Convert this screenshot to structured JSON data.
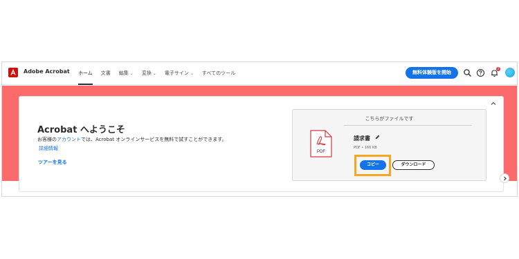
{
  "header": {
    "brand": "Adobe Acrobat",
    "nav": [
      {
        "label": "ホーム",
        "has_menu": false
      },
      {
        "label": "文書",
        "has_menu": false
      },
      {
        "label": "編集",
        "has_menu": true
      },
      {
        "label": "変換",
        "has_menu": true
      },
      {
        "label": "電子サイン",
        "has_menu": true
      },
      {
        "label": "すべてのツール",
        "has_menu": false
      }
    ],
    "trial_button": "無料体験版を開始",
    "notification_count": "2",
    "icons": [
      "search-icon",
      "help-icon",
      "bell-icon",
      "avatar"
    ]
  },
  "welcome": {
    "title": "Acrobat へようこそ",
    "desc_pre": "お客様の",
    "desc_link": "アカウント",
    "desc_post": "では、Acrobat オンラインサービスを無料で試すことができます。",
    "details_link": "詳細情報",
    "tour_link": "ツアーを見る"
  },
  "file_panel": {
    "heading": "こちらがファイルです",
    "file_icon_label": "PDF",
    "file_name": "請求書",
    "file_meta": "PDF • 166 KB",
    "copy_button": "コピー",
    "download_button": "ダウンロード"
  },
  "colors": {
    "accent": "#1473e6",
    "band": "#fb6b6b",
    "highlight": "#f5a623",
    "brand_red": "#c5150e"
  }
}
